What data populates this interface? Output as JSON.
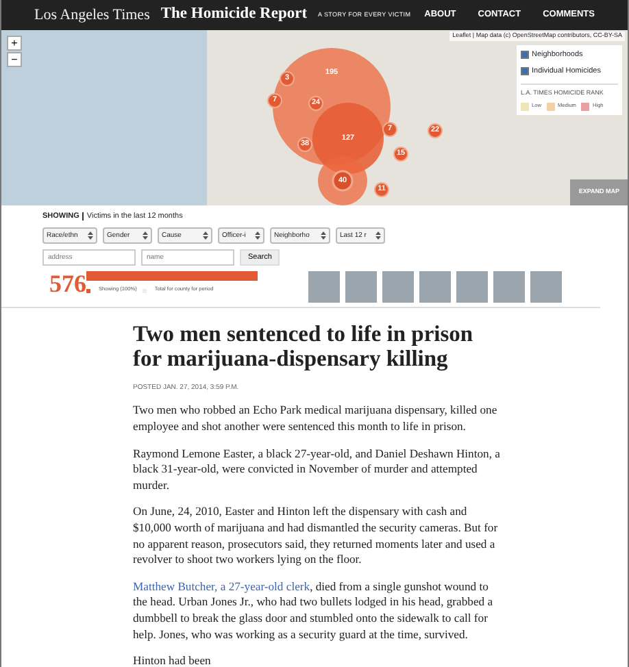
{
  "header": {
    "logo": "Los Angeles Times",
    "title": "The Homicide Report",
    "tagline": "A STORY FOR EVERY VICTIM",
    "nav": [
      {
        "label": "ABOUT"
      },
      {
        "label": "CONTACT"
      },
      {
        "label": "COMMENTS"
      }
    ]
  },
  "map": {
    "zoom_in": "+",
    "zoom_out": "−",
    "attribution": {
      "leaflet": "Leaflet",
      "text1": " | Map data (c) ",
      "osm": "OpenStreetMap",
      "text2": " contributors, ",
      "license": "CC-BY-SA"
    },
    "layers": [
      {
        "label": "Neighborhoods",
        "checked": true
      },
      {
        "label": "Individual Homicides",
        "checked": true
      }
    ],
    "rank_title": "L.A. TIMES HOMICIDE RANK",
    "rank_levels": [
      {
        "label": "Low",
        "color": "#efe6b8"
      },
      {
        "label": "Medium",
        "color": "#f3d1a0"
      },
      {
        "label": "High",
        "color": "#eaa0a0"
      }
    ],
    "clusters": [
      {
        "count": "195",
        "kind": "large"
      },
      {
        "count": "127",
        "kind": "medium"
      },
      {
        "count": "40",
        "kind": "ring"
      },
      {
        "count": "3",
        "kind": "small"
      },
      {
        "count": "24",
        "kind": "small"
      },
      {
        "count": "7",
        "kind": "small"
      },
      {
        "count": "38",
        "kind": "small"
      },
      {
        "count": "7",
        "kind": "small"
      },
      {
        "count": "22",
        "kind": "small"
      },
      {
        "count": "15",
        "kind": "small"
      },
      {
        "count": "11",
        "kind": "small"
      }
    ],
    "expand": "EXPAND MAP"
  },
  "filters": {
    "showing_label": "SHOWING",
    "showing_text": "Victims in the last 12 months",
    "selects": [
      {
        "value": "Race/ethn"
      },
      {
        "value": "Gender"
      },
      {
        "value": "Cause"
      },
      {
        "value": "Officer-i"
      },
      {
        "value": "Neighborho"
      },
      {
        "value": "Last 12 r"
      }
    ],
    "address_placeholder": "address",
    "name_placeholder": "name",
    "search": "Search"
  },
  "summary": {
    "count": "576",
    "level": 1,
    "legend_showing": "Showing (100%)",
    "legend_total": "Total for county for period"
  },
  "victim_photos": [
    {
      "kind": "photo"
    },
    {
      "kind": "photo"
    },
    {
      "kind": "photo"
    },
    {
      "kind": "photo"
    },
    {
      "kind": "photo"
    },
    {
      "kind": "photo"
    },
    {
      "kind": "photo"
    }
  ],
  "article": {
    "headline": "Two men sentenced to life in prison for marijuana-dispensary killing",
    "posted": "POSTED JAN. 27, 2014, 3:59 P.M.",
    "paragraphs": [
      {
        "text": "Two men who robbed an Echo Park medical marijuana dispensary, killed one employee and shot another were sentenced this month to life in prison."
      },
      {
        "text": "Raymond Lemone Easter, a black 27-year-old, and Daniel Deshawn Hinton, a black 31-year-old, were convicted in November of murder and attempted murder."
      },
      {
        "text": "On June, 24, 2010, Easter and Hinton left the dispensary with cash and $10,000 worth of marijuana and had dismantled the security cameras. But for no apparent reason, prosecutors said, they returned moments later and used a revolver to shoot two workers lying on the floor."
      },
      {
        "link": "Matthew Butcher, a 27-year-old clerk",
        "text": ", died from a single gunshot wound to the head. Urban Jones Jr., who had two bullets lodged in his head, grabbed a dumbbell to break the glass door and stumbled onto the sidewalk to call for help. Jones, who was working as a security guard at the time, survived."
      },
      {
        "text": "Hinton had been"
      }
    ]
  }
}
